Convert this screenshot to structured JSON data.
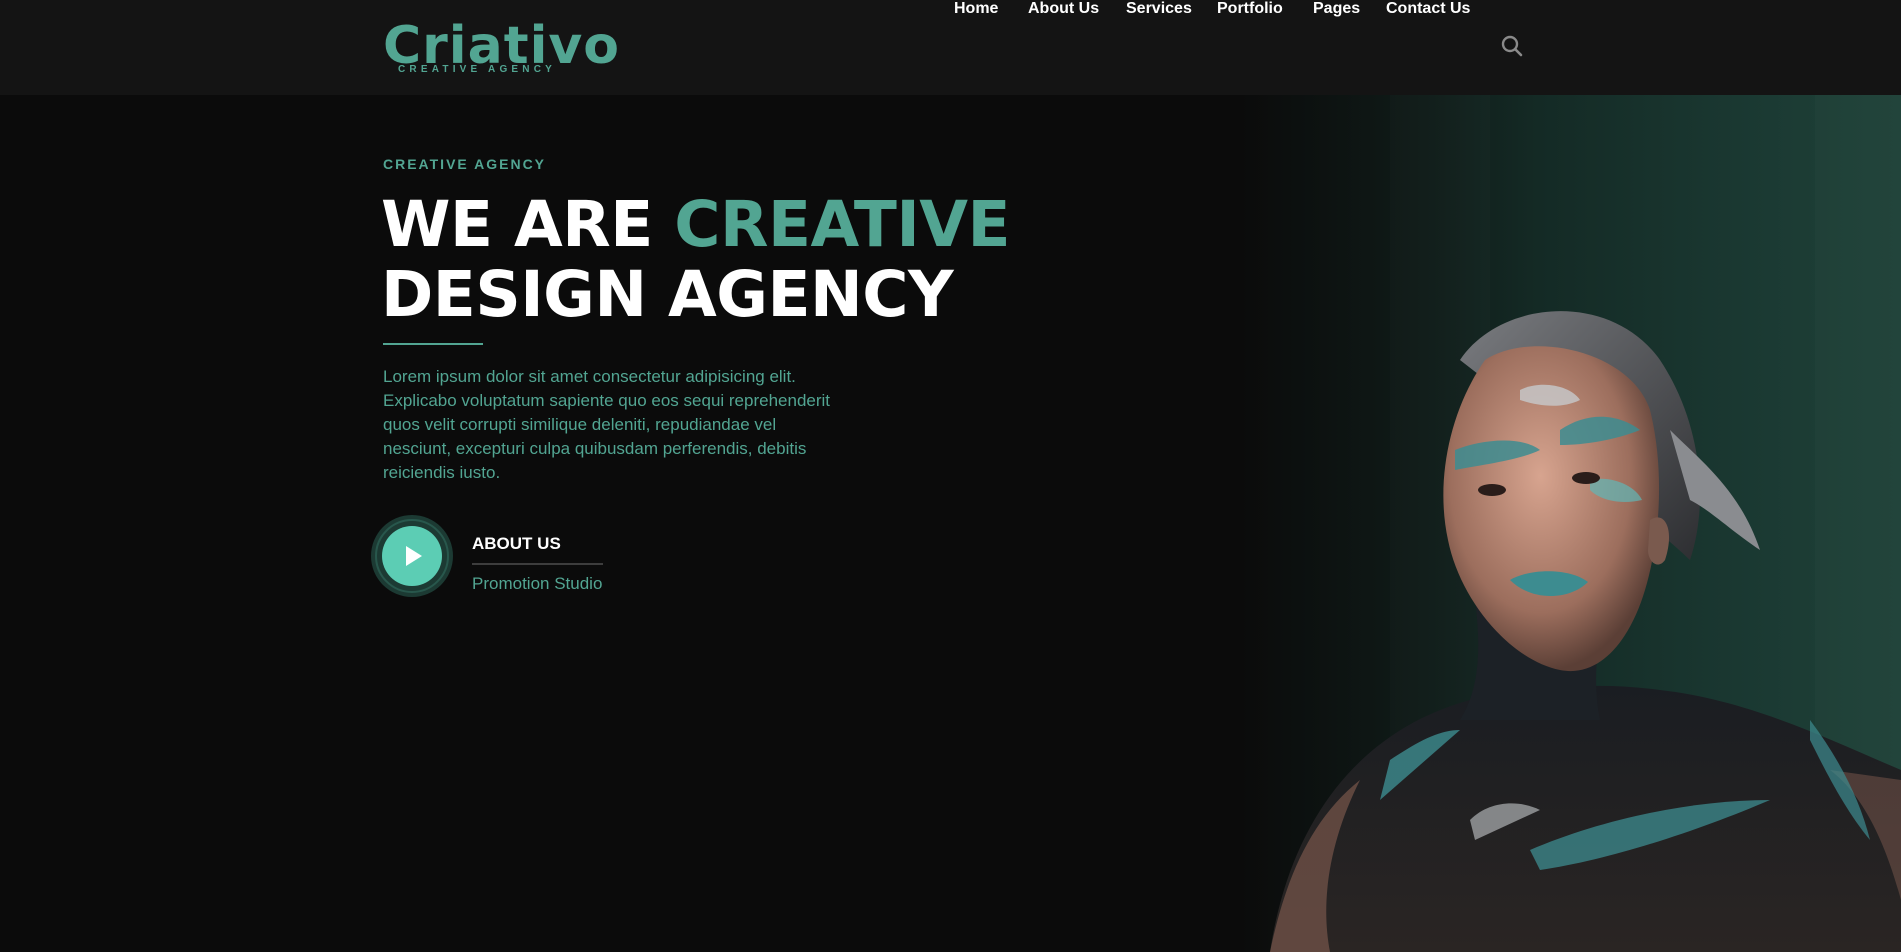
{
  "brand": {
    "name": "Criativo",
    "tagline": "CREATIVE AGENCY",
    "accent_color": "#52a592"
  },
  "nav": {
    "items": [
      {
        "label": "Home"
      },
      {
        "label": "About Us"
      },
      {
        "label": "Services"
      },
      {
        "label": "Portfolio"
      },
      {
        "label": "Pages"
      },
      {
        "label": "Contact Us"
      }
    ],
    "search_icon": "search-icon"
  },
  "hero": {
    "eyebrow": "CREATIVE AGENCY",
    "headline_part1": "WE ARE",
    "headline_accent": "CREATIVE",
    "headline_line2": "DESIGN AGENCY",
    "body_lines": [
      "Lorem ipsum dolor sit amet consectetur adipisicing elit.",
      "Explicabo voluptatum sapiente quo eos sequi reprehenderit",
      "quos velit corrupti similique deleniti, repudiandae vel",
      "nesciunt, excepturi culpa quibusdam perferendis, debitis",
      "reiciendis iusto."
    ],
    "play_icon": "play-icon",
    "about_label": "ABOUT US",
    "about_sub": "Promotion Studio",
    "image": "face-paint-portrait"
  },
  "colors": {
    "background": "#0b0b0b",
    "header": "#141414",
    "accent": "#52a592",
    "play_button": "#5ccdb4"
  }
}
